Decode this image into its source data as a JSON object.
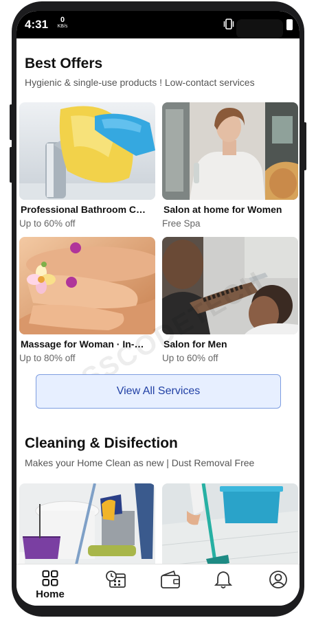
{
  "status_bar": {
    "time": "4:31",
    "net_speed_value": "0",
    "net_speed_unit": "KB/s"
  },
  "best_offers": {
    "title": "Best Offers",
    "subtitle": "Hygienic & single-use products ! Low-contact services",
    "cards": [
      {
        "name": "Professional Bathroom Cleaning",
        "offer": "Up to 60% off"
      },
      {
        "name": "Salon at home for Women",
        "offer": "Free Spa"
      },
      {
        "name": "Massage for Woman · In-Home",
        "offer": "Up to 80% off"
      },
      {
        "name": "Salon for Men",
        "offer": "Up to 60% off"
      }
    ]
  },
  "view_all_label": "View All Services",
  "cleaning": {
    "title": "Cleaning & Disifection",
    "subtitle": "Makes your Home Clean as new | Dust Removal Free"
  },
  "watermark_text": "CSSCODETECH",
  "bottom_nav": {
    "items": [
      {
        "label": "Home",
        "icon": "grid-icon"
      },
      {
        "label": "",
        "icon": "calendar-clock-icon"
      },
      {
        "label": "",
        "icon": "wallet-icon"
      },
      {
        "label": "",
        "icon": "bell-icon"
      },
      {
        "label": "",
        "icon": "profile-icon"
      }
    ]
  },
  "colors": {
    "accent": "#2140a5",
    "button_bg": "#e7efff",
    "button_border": "#7c9ce0"
  }
}
